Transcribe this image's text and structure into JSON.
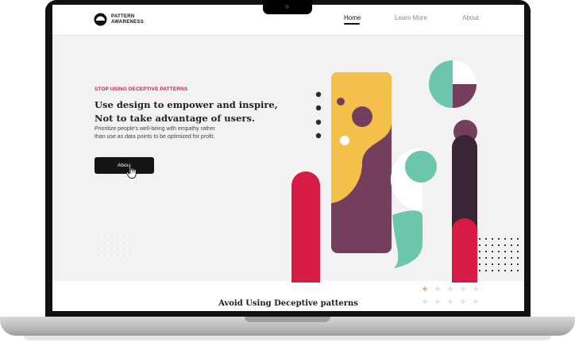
{
  "nav": {
    "logo_line1": "PATTERN",
    "logo_line2": "AWARENESS",
    "links": [
      "Home",
      "Learn More",
      "About"
    ],
    "active": "Home"
  },
  "hero": {
    "eyebrow": "STOP USING DECEPTIVE PATTERNS",
    "headline_line1": "Use design to empower and inspire,",
    "headline_line2": "Not to take advantage of users.",
    "subtext_line1": "Prioritize people's well-being with empathy rather",
    "subtext_line2": "than use as data points to be optimized for profit.",
    "button_label": "About"
  },
  "section": {
    "title": "Avoid Using Deceptive patterns"
  },
  "colors": {
    "accent_red": "#d81b45",
    "yellow": "#f4c04a",
    "plum": "#733f5d",
    "teal": "#6cc6ad",
    "dark_plum": "#3a2535",
    "button": "#141414"
  },
  "icons": [
    "logo-mark-icon",
    "pointer-cursor-icon"
  ]
}
